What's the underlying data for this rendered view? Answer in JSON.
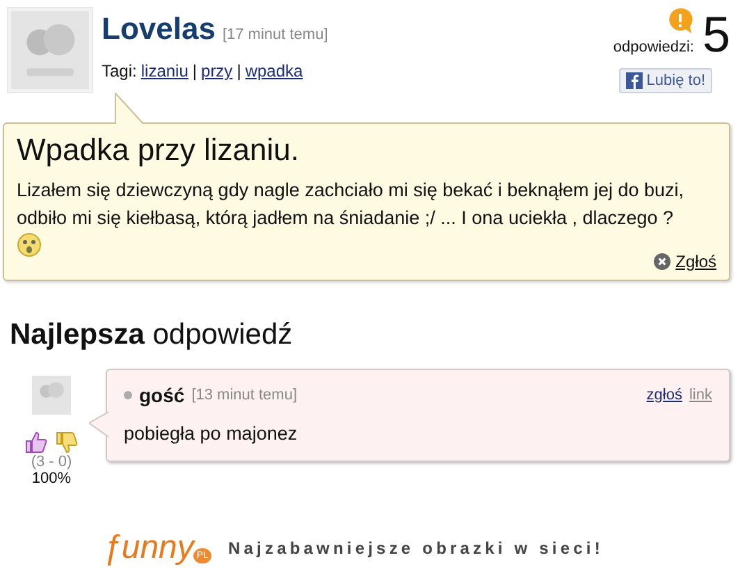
{
  "question": {
    "author": "Lovelas",
    "time": "[17 minut temu]",
    "tags_label": "Tagi:",
    "tags": [
      {
        "label": "lizaniu"
      },
      {
        "label": "przy"
      },
      {
        "label": "wpadka"
      }
    ],
    "tag_separators": [
      "|",
      "|"
    ],
    "answers_label": "odpowiedzi:",
    "answers_count": "5",
    "like_button": "Lubię to!",
    "title": "Wpadka przy lizaniu.",
    "body": "Lizałem się dziewczyną gdy nagle zachciało mi się bekać i beknąłem jej do buzi, odbiło mi się kiełbasą, którą jadłem na śniadanie ;/ ... I ona uciekła , dlaczego ?",
    "report": "Zgłoś"
  },
  "best_answer": {
    "heading_bold": "Najlepsza",
    "heading_rest": "odpowiedź",
    "author": "gość",
    "time": "[13 minut temu]",
    "report": "zgłoś",
    "link": "link",
    "text": "pobiegła po majonez",
    "votes": "(3 - 0)",
    "percent": "100%"
  },
  "footer": {
    "logo": "ƒunny",
    "logo_badge": "PL",
    "tagline": "Najzabawniejsze obrazki w sieci!"
  }
}
